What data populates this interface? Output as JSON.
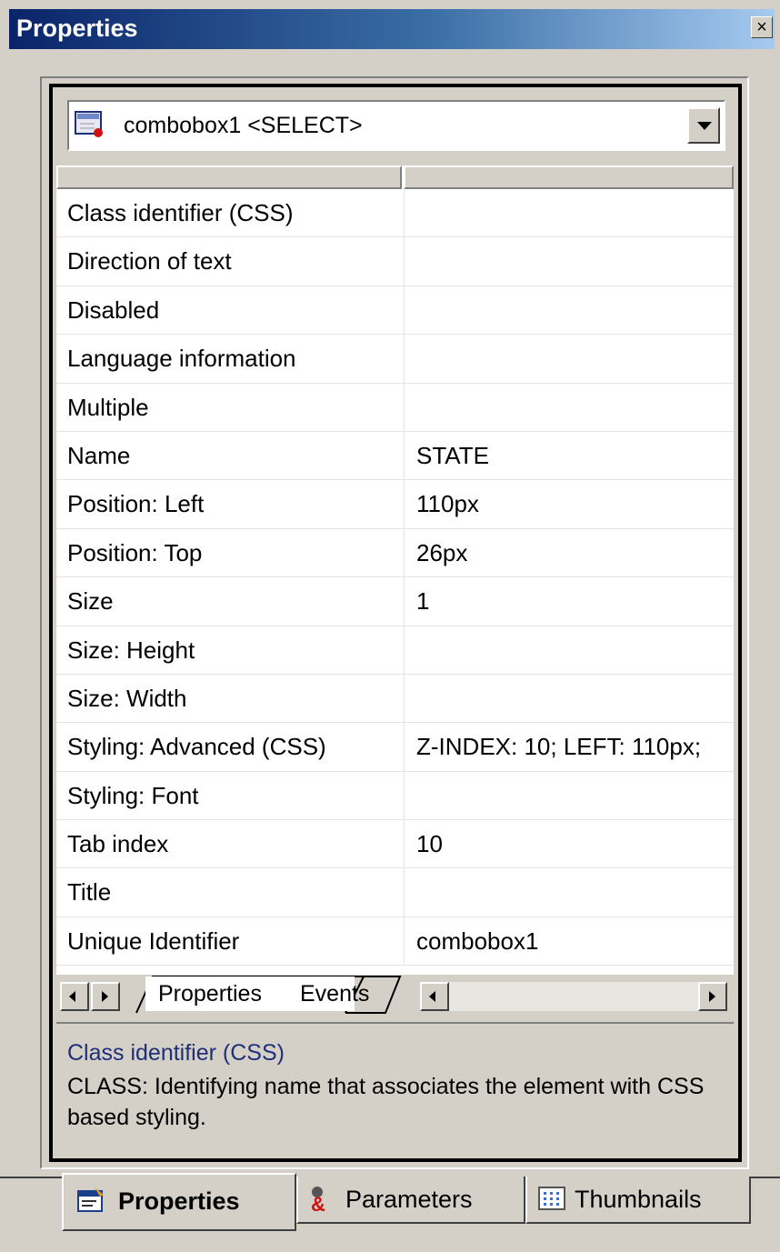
{
  "window": {
    "title": "Properties",
    "close_glyph": "×"
  },
  "object_selector": {
    "value": "combobox1 <SELECT>"
  },
  "properties": [
    {
      "name": "Class identifier (CSS)",
      "value": ""
    },
    {
      "name": "Direction of text",
      "value": ""
    },
    {
      "name": "Disabled",
      "value": ""
    },
    {
      "name": "Language information",
      "value": ""
    },
    {
      "name": "Multiple",
      "value": ""
    },
    {
      "name": "Name",
      "value": "STATE"
    },
    {
      "name": "Position: Left",
      "value": "110px"
    },
    {
      "name": "Position: Top",
      "value": "26px"
    },
    {
      "name": "Size",
      "value": "1"
    },
    {
      "name": "Size: Height",
      "value": ""
    },
    {
      "name": "Size: Width",
      "value": ""
    },
    {
      "name": "Styling: Advanced (CSS)",
      "value": "Z-INDEX: 10; LEFT: 110px;"
    },
    {
      "name": "Styling: Font",
      "value": ""
    },
    {
      "name": "Tab index",
      "value": "10"
    },
    {
      "name": "Title",
      "value": ""
    },
    {
      "name": "Unique Identifier",
      "value": "combobox1"
    }
  ],
  "grid_tabs": {
    "properties_label": "Properties",
    "events_label": "Events"
  },
  "description": {
    "title": "Class identifier (CSS)",
    "text": "CLASS: Identifying name that associates the element with CSS based styling."
  },
  "bottom_tabs": {
    "properties_label": "Properties",
    "parameters_label": "Parameters",
    "thumbnails_label": "Thumbnails"
  },
  "colors": {
    "titlebar_start": "#0a246a",
    "titlebar_end": "#a6caf0",
    "description_title": "#1f2f78",
    "face": "#d4d0c8"
  }
}
